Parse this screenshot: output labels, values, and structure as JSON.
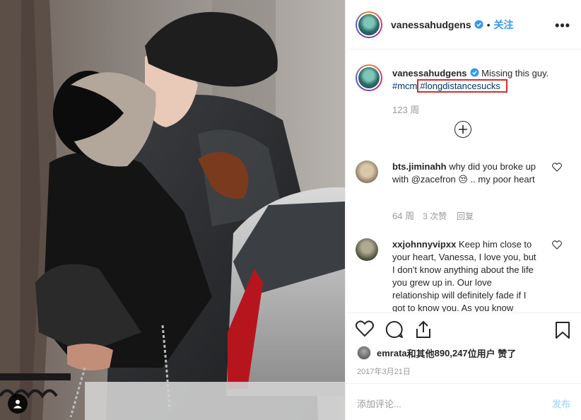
{
  "post": {
    "author": "vanessahudgens",
    "follow_label": "关注",
    "separator": "•",
    "more_label": "•••",
    "verified_icon": "verified-badge-icon",
    "caption": {
      "text": "Missing this guy.",
      "hashtag_1": "#mcm",
      "hashtag_2": "#longdistancesucks",
      "highlight_color": "#d32f2f",
      "time": "123 周"
    },
    "load_more_icon": "plus-circle-icon",
    "comments": [
      {
        "username": "bts.jiminahh",
        "text": "why did you broke up with @zacefron 😒 .. my poor heart",
        "time": "64 周",
        "likes": "3 次赞",
        "reply": "回复"
      },
      {
        "username": "xxjohnnyvipxx",
        "text": "Keep him close to your heart, Vanessa, I love you, but I don't know anything about the life you grew up in. Our love relationship will definitely fade if I got to know you. As you know"
      }
    ],
    "likes": {
      "first_user": "emrata",
      "joiner": " 和 ",
      "others_prefix": "其他 ",
      "count": "890,247",
      "suffix": " 位用户 赞了"
    },
    "date": "2017年3月21日",
    "add_comment": {
      "placeholder": "添加评论...",
      "post_label": "发布"
    }
  },
  "colors": {
    "accent": "#3897f0",
    "hashtag": "#003569",
    "muted": "#999999",
    "post_disabled": "#b2dffc"
  }
}
